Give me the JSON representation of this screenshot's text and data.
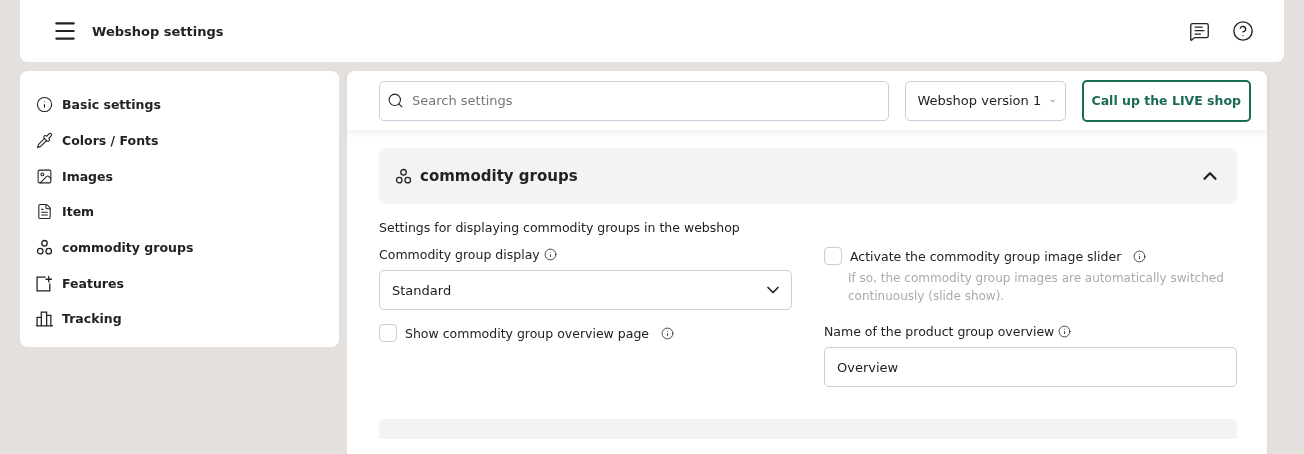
{
  "header": {
    "title": "Webshop settings"
  },
  "sidebar": {
    "items": [
      {
        "label": "Basic settings",
        "kind": "info"
      },
      {
        "label": "Colors / Fonts",
        "kind": "pipette"
      },
      {
        "label": "Images",
        "kind": "image"
      },
      {
        "label": "Item",
        "kind": "document"
      },
      {
        "label": "commodity groups",
        "kind": "circles"
      },
      {
        "label": "Features",
        "kind": "add"
      },
      {
        "label": "Tracking",
        "kind": "chart"
      }
    ]
  },
  "toolbar": {
    "search": {
      "placeholder": "Search settings"
    },
    "version_select": {
      "value": "Webshop version 1"
    },
    "live_button": "Call up the LIVE shop"
  },
  "section": {
    "title": "commodity groups",
    "expanded": true,
    "description": "Settings for displaying commodity groups in the webshop",
    "display_field": {
      "label": "Commodity group display",
      "value": "Standard"
    },
    "slider_option": {
      "label": "Activate the commodity group image slider",
      "checked": false,
      "hint": "If so, the commodity group images are automatically switched continuously (slide show)."
    },
    "overview_option": {
      "label": "Show commodity group overview page",
      "checked": false
    },
    "overview_name": {
      "label": "Name of the product group overview",
      "value": "Overview"
    }
  }
}
